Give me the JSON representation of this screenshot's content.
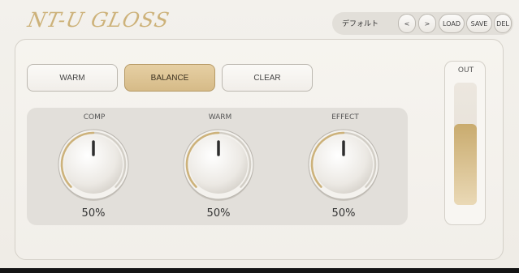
{
  "plugin": {
    "name": "NT-U GLOSS"
  },
  "preset": {
    "name": "デフォルト",
    "prev_label": "<",
    "next_label": ">",
    "load_label": "LOAD",
    "save_label": "SAVE",
    "del_label": "DEL"
  },
  "modes": {
    "warm_label": "WARM",
    "balance_label": "BALANCE",
    "clear_label": "CLEAR",
    "selected": "BALANCE"
  },
  "knobs": [
    {
      "label": "COMP",
      "value": "50%",
      "level": 0.5
    },
    {
      "label": "WARM",
      "value": "50%",
      "level": 0.5
    },
    {
      "label": "EFFECT",
      "value": "50%",
      "level": 0.5
    }
  ],
  "output": {
    "label": "OUT",
    "level": 0.66
  },
  "colors": {
    "accent": "#cdb27a",
    "active_button": "#d6bb88",
    "panel": "#f3f1ec",
    "knob_area": "#e2dfda"
  }
}
